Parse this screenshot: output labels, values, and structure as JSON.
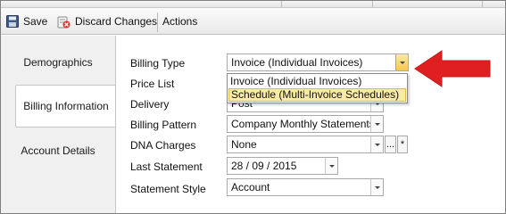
{
  "toolbar": {
    "save_label": "Save",
    "discard_label": "Discard Changes",
    "actions_label": "Actions"
  },
  "tabs": [
    {
      "label": "Demographics",
      "active": false
    },
    {
      "label": "Billing Information",
      "active": true
    },
    {
      "label": "Account Details",
      "active": false
    }
  ],
  "form": {
    "billing_type": {
      "label": "Billing Type",
      "value": "Invoice (Individual Invoices)"
    },
    "price_list": {
      "label": "Price List",
      "value": ""
    },
    "delivery": {
      "label": "Delivery",
      "value": "Post"
    },
    "billing_pattern": {
      "label": "Billing Pattern",
      "value": "Company Monthly Statements"
    },
    "dna_charges": {
      "label": "DNA Charges",
      "value": "None",
      "ellipsis_label": "...",
      "asterisk_label": "*"
    },
    "last_statement": {
      "label": "Last Statement",
      "value": "28 / 09 / 2015"
    },
    "statement_style": {
      "label": "Statement Style",
      "value": "Account"
    }
  },
  "billing_type_dropdown": {
    "options": [
      {
        "label": "Invoice (Individual Invoices)",
        "highlighted": false
      },
      {
        "label": "Schedule (Multi-Invoice Schedules)",
        "highlighted": true
      }
    ]
  },
  "colors": {
    "annotation_arrow": "#e02020",
    "highlight": "#fbe9a6"
  }
}
